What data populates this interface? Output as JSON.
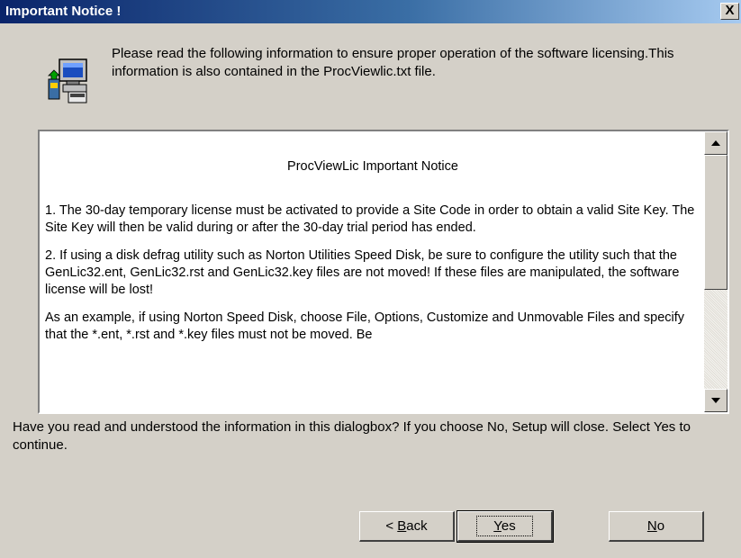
{
  "window": {
    "title": "Important Notice !",
    "close_label": "X"
  },
  "header": {
    "icon": "computer-install-icon",
    "intro_text": "Please read the following information to ensure proper operation of the software licensing.This information is also contained in the ProcViewlic.txt file."
  },
  "notice": {
    "title": "ProcViewLic Important Notice",
    "paragraphs": [
      "1. The 30-day temporary license must be activated to provide a Site Code in order to obtain a valid Site Key.  The Site Key will then be valid during or after the 30-day trial period has ended.",
      "2. If using a disk defrag utility such as Norton Utilities Speed Disk, be sure to configure the utility such that the GenLic32.ent, GenLic32.rst and GenLic32.key files are not moved!  If these files are manipulated, the software license will be lost!",
      "As an example, if using Norton Speed Disk, choose File, Options, Customize and Unmovable Files and specify that the *.ent, *.rst and *.key files must not be moved.  Be"
    ]
  },
  "question": "Have you read and understood the information in this dialogbox? If you choose No, Setup will close. Select Yes to continue.",
  "buttons": {
    "back_prefix": "< ",
    "back_hotkey": "B",
    "back_rest": "ack",
    "yes_hotkey": "Y",
    "yes_rest": "es",
    "no_hotkey": "N",
    "no_rest": "o"
  }
}
